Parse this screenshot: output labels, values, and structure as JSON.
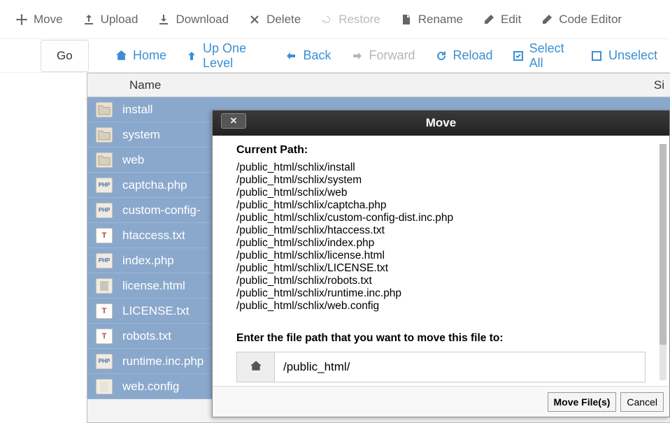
{
  "toolbar": {
    "move": {
      "label": "Move",
      "icon": "move-icon"
    },
    "upload": {
      "label": "Upload",
      "icon": "upload-icon"
    },
    "download": {
      "label": "Download",
      "icon": "download-icon"
    },
    "delete": {
      "label": "Delete",
      "icon": "delete-icon"
    },
    "restore": {
      "label": "Restore",
      "icon": "restore-icon",
      "disabled": true
    },
    "rename": {
      "label": "Rename",
      "icon": "rename-icon"
    },
    "edit": {
      "label": "Edit",
      "icon": "edit-icon"
    },
    "code": {
      "label": "Code Editor",
      "icon": "code-icon"
    }
  },
  "nav": {
    "go": {
      "label": "Go"
    },
    "home": {
      "label": "Home",
      "icon": "home-icon"
    },
    "up": {
      "label": "Up One Level",
      "icon": "up-icon"
    },
    "back": {
      "label": "Back",
      "icon": "back-icon"
    },
    "forward": {
      "label": "Forward",
      "icon": "forward-icon",
      "disabled": true
    },
    "reload": {
      "label": "Reload",
      "icon": "reload-icon"
    },
    "selectall": {
      "label": "Select All",
      "icon": "selectall-icon"
    },
    "unselect": {
      "label": "Unselect",
      "icon": "unselect-icon"
    }
  },
  "columns": {
    "name": "Name",
    "size": "Si"
  },
  "files": [
    {
      "name": "install",
      "type": "folder"
    },
    {
      "name": "system",
      "type": "folder"
    },
    {
      "name": "web",
      "type": "folder"
    },
    {
      "name": "captcha.php",
      "type": "php"
    },
    {
      "name": "custom-config-",
      "type": "php"
    },
    {
      "name": "htaccess.txt",
      "type": "txt"
    },
    {
      "name": "index.php",
      "type": "php"
    },
    {
      "name": "license.html",
      "type": "html"
    },
    {
      "name": "LICENSE.txt",
      "type": "txt"
    },
    {
      "name": "robots.txt",
      "type": "txt"
    },
    {
      "name": "runtime.inc.php",
      "type": "php"
    },
    {
      "name": "web.config",
      "type": "cfg"
    }
  ],
  "modal": {
    "title": "Move",
    "current_path_label": "Current Path:",
    "paths": [
      "/public_html/schlix/install",
      "/public_html/schlix/system",
      "/public_html/schlix/web",
      "/public_html/schlix/captcha.php",
      "/public_html/schlix/custom-config-dist.inc.php",
      "/public_html/schlix/htaccess.txt",
      "/public_html/schlix/index.php",
      "/public_html/schlix/license.html",
      "/public_html/schlix/LICENSE.txt",
      "/public_html/schlix/robots.txt",
      "/public_html/schlix/runtime.inc.php",
      "/public_html/schlix/web.config"
    ],
    "enter_label": "Enter the file path that you want to move this file to:",
    "input_value": "/public_html/",
    "move_btn": "Move File(s)",
    "cancel_btn": "Cancel"
  }
}
